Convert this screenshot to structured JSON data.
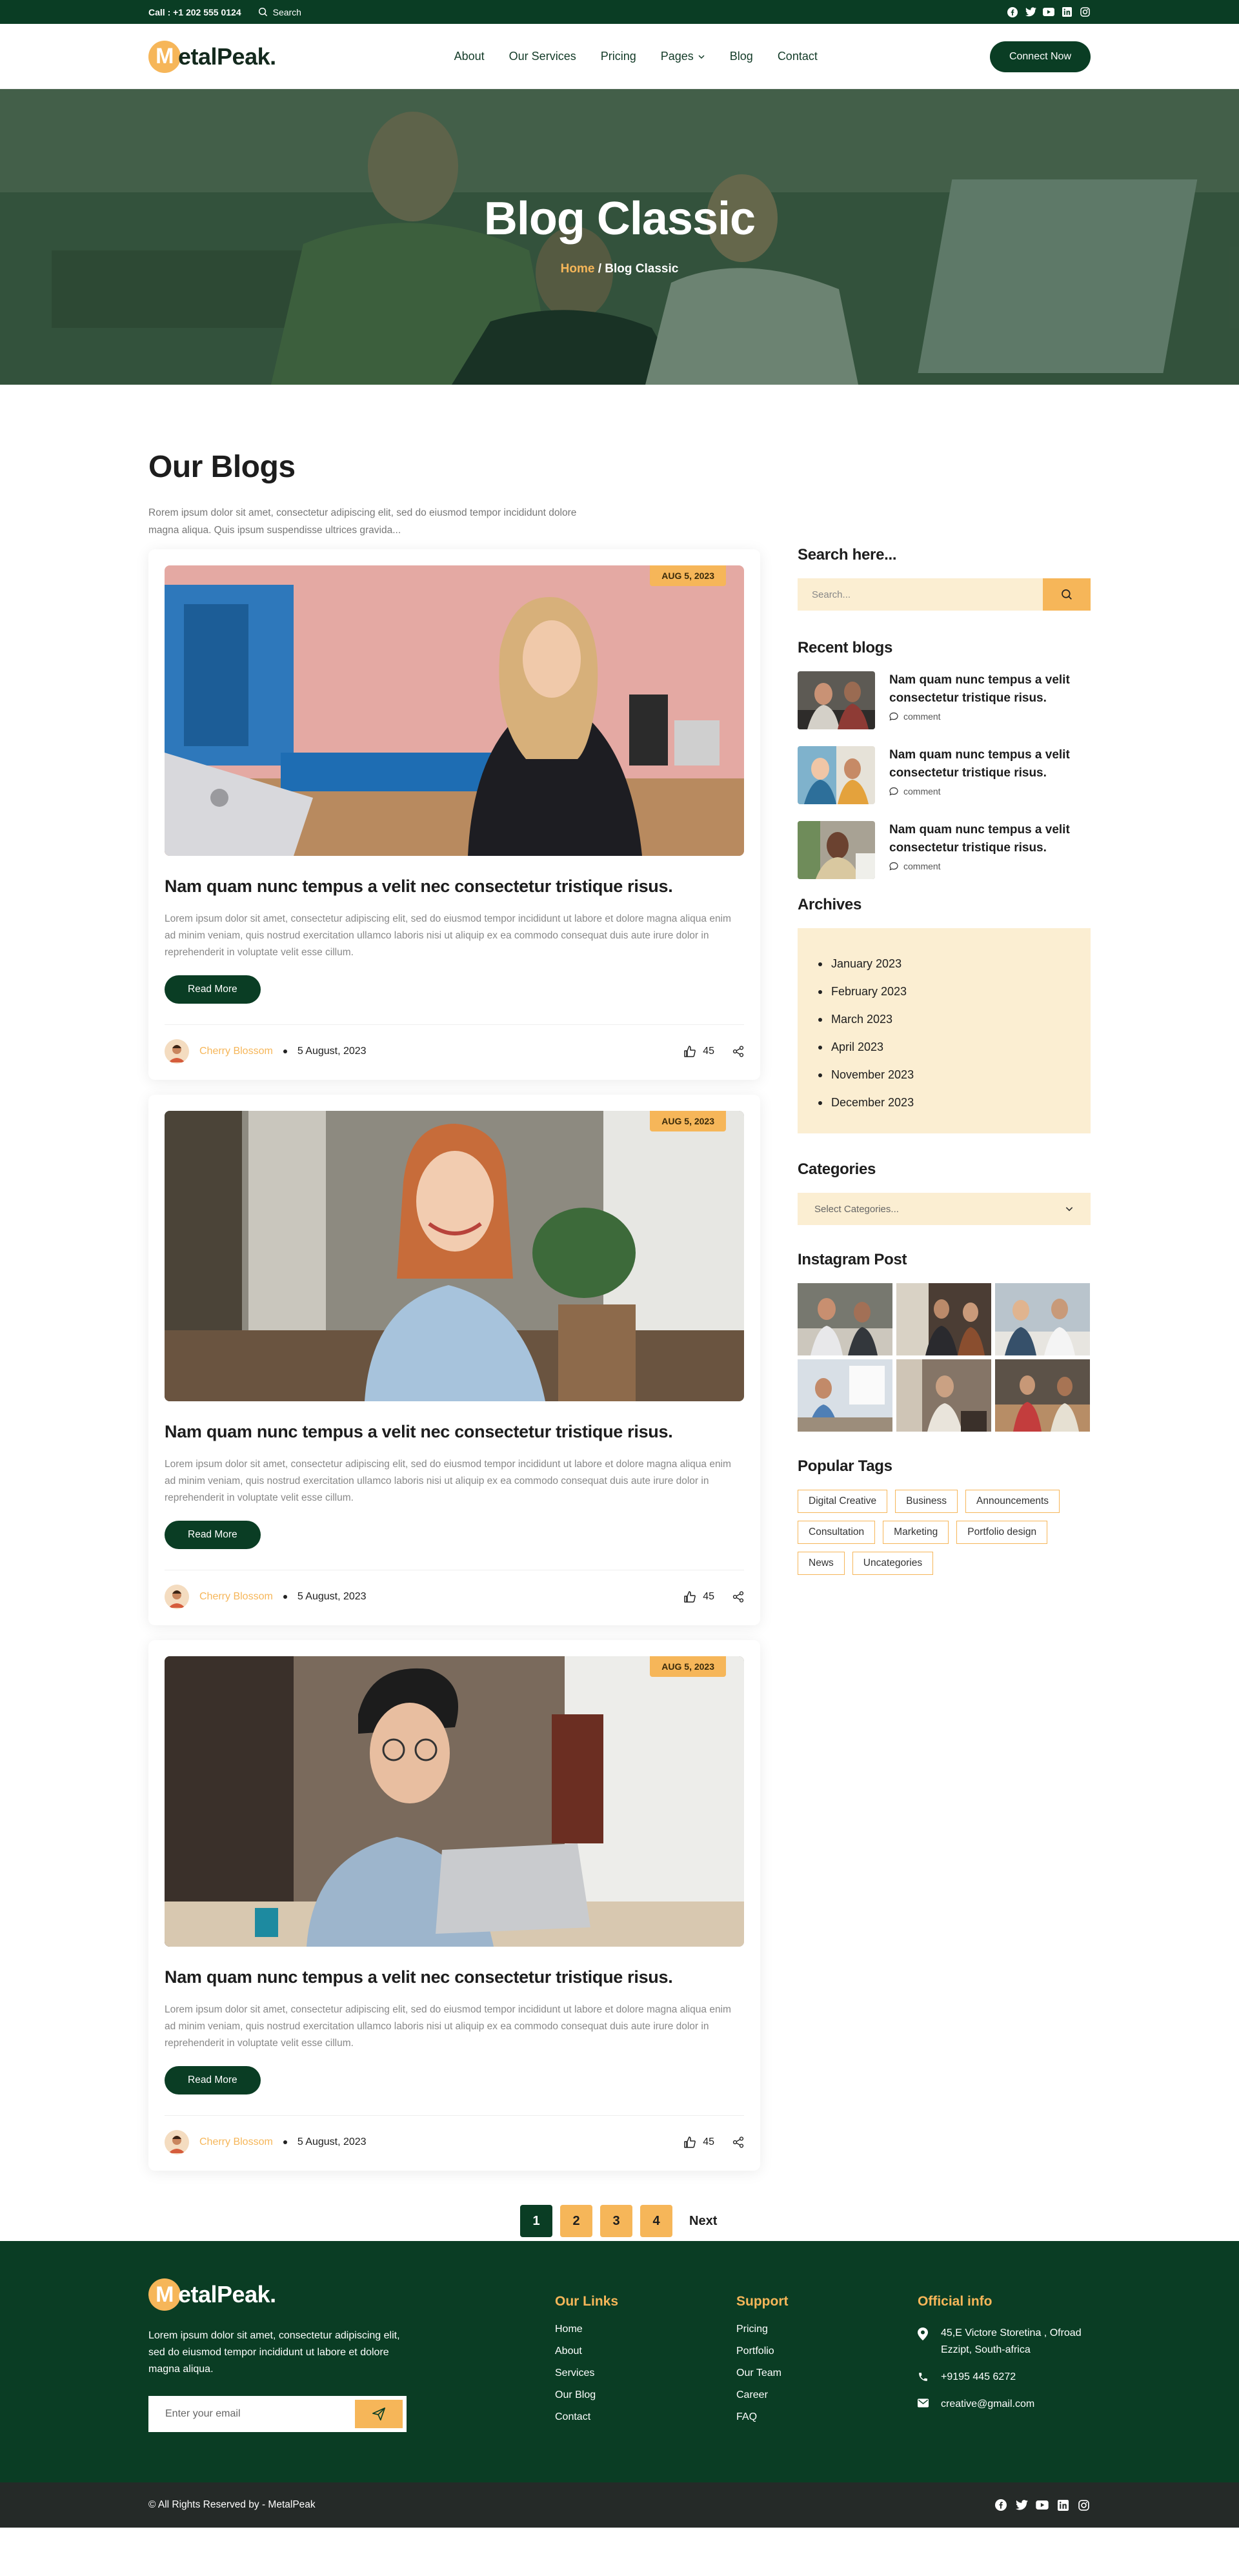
{
  "topbar": {
    "phone": "Call : +1 202 555 0124",
    "search_label": "Search",
    "social": [
      "facebook-icon",
      "twitter-icon",
      "youtube-icon",
      "linkedin-icon",
      "instagram-icon"
    ]
  },
  "header": {
    "logo_letter": "M",
    "logo_rest": "etalPeak.",
    "nav": [
      {
        "label": "About"
      },
      {
        "label": "Our Services"
      },
      {
        "label": "Pricing"
      },
      {
        "label": "Pages"
      },
      {
        "label": "Blog"
      },
      {
        "label": "Contact"
      }
    ],
    "cta": "Connect Now"
  },
  "hero": {
    "title": "Blog Classic",
    "crumb_home": "Home",
    "crumb_sep": " / ",
    "crumb_current": "Blog Classic"
  },
  "blog": {
    "title": "Our Blogs",
    "intro": "Rorem ipsum dolor sit amet, consectetur adipiscing elit, sed do eiusmod tempor incididunt dolore magna aliqua. Quis ipsum suspendisse ultrices gravida...",
    "posts": [
      {
        "date": "AUG 5, 2023",
        "title": "Nam quam nunc tempus a velit nec consectetur tristique risus.",
        "excerpt": "Lorem ipsum dolor sit amet, consectetur adipiscing elit, sed do eiusmod tempor incididunt ut labore et dolore magna aliqua enim ad minim veniam, quis nostrud exercitation ullamco laboris nisi ut aliquip ex ea commodo consequat duis aute irure dolor in reprehenderit in voluptate velit esse cillum.",
        "read_more": "Read More",
        "author": "Cherry Blossom",
        "post_date": "5 August, 2023",
        "likes": "45"
      },
      {
        "date": "AUG 5, 2023",
        "title": "Nam quam nunc tempus a velit nec consectetur tristique risus.",
        "excerpt": "Lorem ipsum dolor sit amet, consectetur adipiscing elit, sed do eiusmod tempor incididunt ut labore et dolore magna aliqua enim ad minim veniam, quis nostrud exercitation ullamco laboris nisi ut aliquip ex ea commodo consequat duis aute irure dolor in reprehenderit in voluptate velit esse cillum.",
        "read_more": "Read More",
        "author": "Cherry Blossom",
        "post_date": "5 August, 2023",
        "likes": "45"
      },
      {
        "date": "AUG 5, 2023",
        "title": "Nam quam nunc tempus a velit nec consectetur tristique risus.",
        "excerpt": "Lorem ipsum dolor sit amet, consectetur adipiscing elit, sed do eiusmod tempor incididunt ut labore et dolore magna aliqua enim ad minim veniam, quis nostrud exercitation ullamco laboris nisi ut aliquip ex ea commodo consequat duis aute irure dolor in reprehenderit in voluptate velit esse cillum.",
        "read_more": "Read More",
        "author": "Cherry Blossom",
        "post_date": "5 August, 2023",
        "likes": "45"
      }
    ],
    "pagination": [
      "1",
      "2",
      "3",
      "4"
    ],
    "next": "Next"
  },
  "sidebar": {
    "search_title": "Search here...",
    "search_placeholder": "Search...",
    "recent_title": "Recent blogs",
    "recent": [
      {
        "title": "Nam quam nunc tempus a velit consectetur tristique risus.",
        "meta": "comment"
      },
      {
        "title": "Nam quam nunc tempus a velit consectetur tristique risus.",
        "meta": "comment"
      },
      {
        "title": "Nam quam nunc tempus a velit consectetur tristique risus.",
        "meta": "comment"
      }
    ],
    "archives_title": "Archives",
    "archives": [
      "January 2023",
      "February 2023",
      "March 2023",
      "April 2023",
      "November 2023",
      "December 2023"
    ],
    "categories_title": "Categories",
    "categories_selected": "Select Categories...",
    "instagram_title": "Instagram Post",
    "tags_title": "Popular Tags",
    "tags": [
      "Digital Creative",
      "Business",
      "Announcements",
      "Consultation",
      "Marketing",
      "Portfolio design",
      "News",
      "Uncategories"
    ]
  },
  "footer": {
    "about": "Lorem ipsum dolor sit amet, consectetur adipiscing elit, sed do eiusmod tempor incididunt ut labore et dolore magna aliqua.",
    "newsletter_placeholder": "Enter your email",
    "links_title": "Our Links",
    "links": [
      "Home",
      "About",
      "Services",
      "Our Blog",
      "Contact"
    ],
    "support_title": "Support",
    "support": [
      "Pricing",
      "Portfolio",
      "Our Team",
      "Career",
      "FAQ"
    ],
    "info_title": "Official info",
    "address": "45,E Victore Storetina , Ofroad Ezzipt, South-africa",
    "phone": "+9195 445 6272",
    "email": "creative@gmail.com",
    "copyright": "© All Rights Reserved by - MetalPeak"
  },
  "colors": {
    "brand_green": "#0a3d24",
    "accent_orange": "#f6b659",
    "cream": "#fbeed2"
  }
}
